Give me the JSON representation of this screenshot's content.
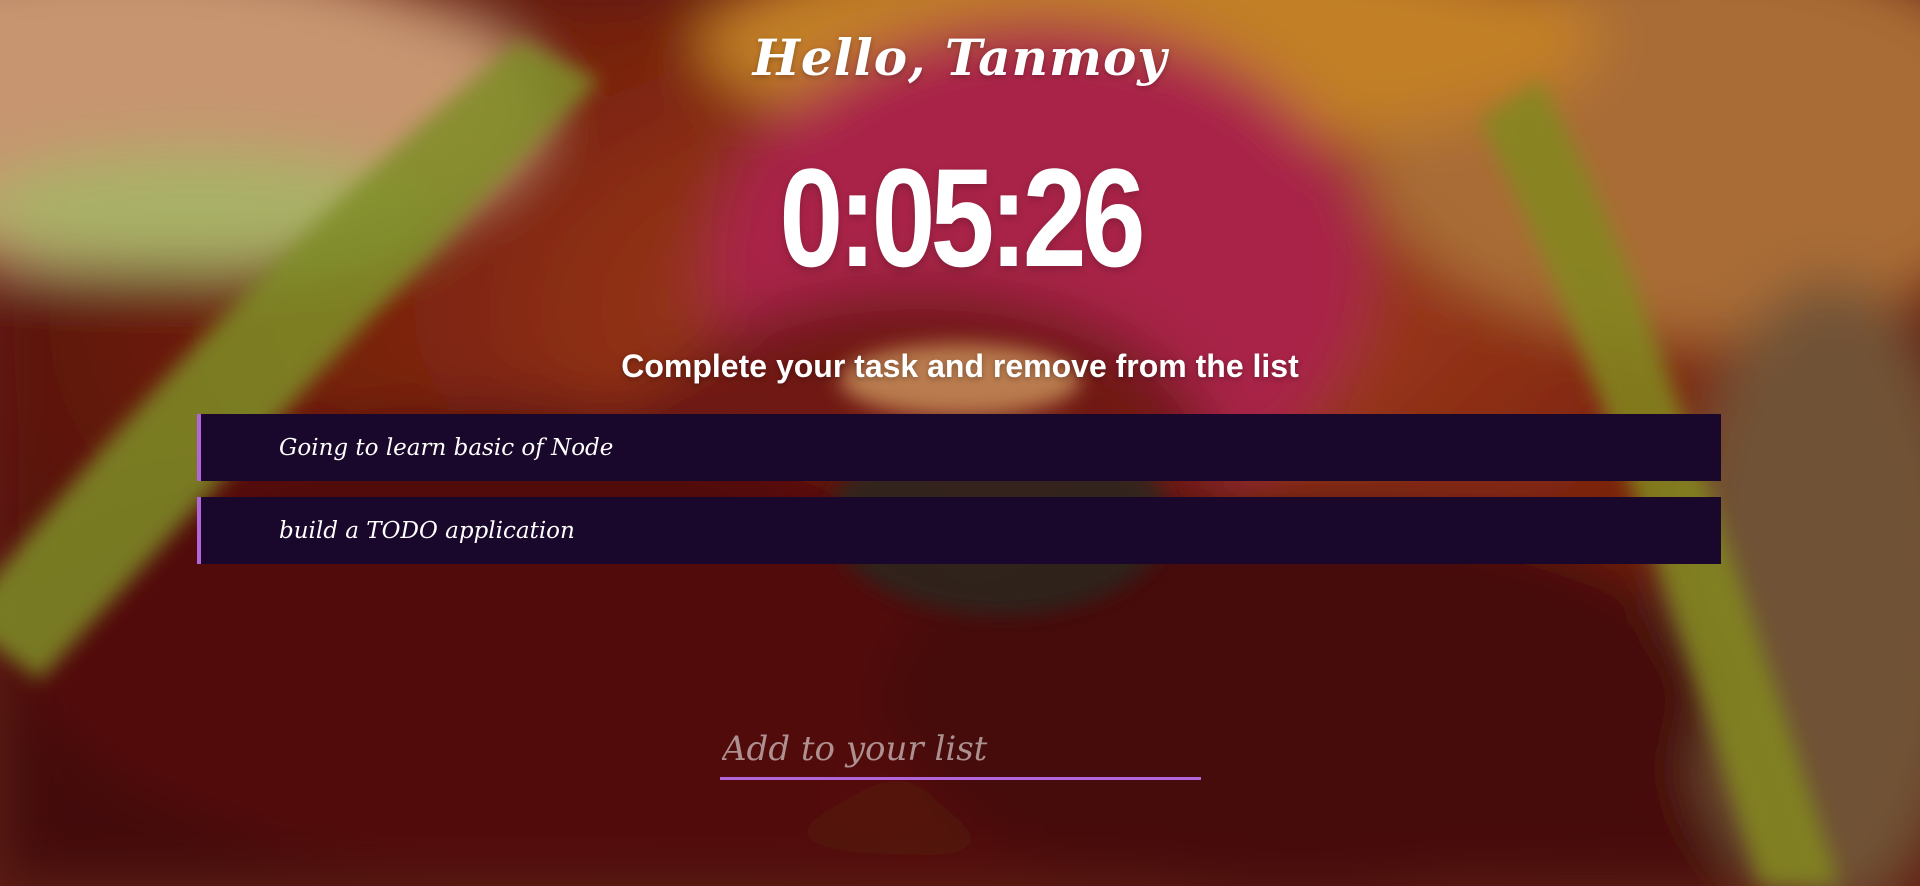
{
  "header": {
    "greeting": "Hello, Tanmoy"
  },
  "clock": {
    "time": "0:05:26"
  },
  "tasks": {
    "heading": "Complete your task and remove from the list",
    "items": [
      {
        "label": "Going to learn basic of Node"
      },
      {
        "label": "build a TODO application"
      }
    ]
  },
  "add_task": {
    "placeholder": "Add to your list"
  },
  "colors": {
    "task_background": "#19082b",
    "accent": "#b366d9",
    "text": "#ffffff"
  }
}
